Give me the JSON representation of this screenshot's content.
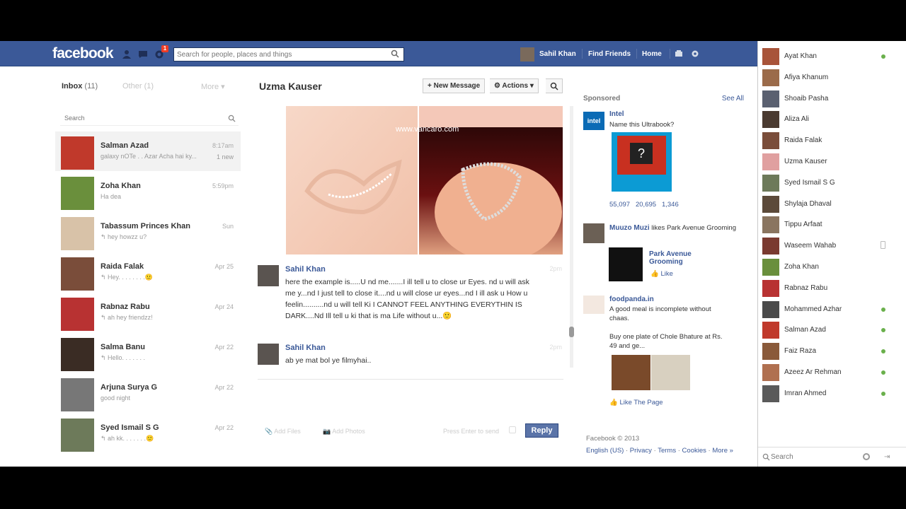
{
  "header": {
    "logo": "facebook",
    "notification_count": "1",
    "search_placeholder": "Search for people, places and things",
    "user_name": "Sahil Khan",
    "find_friends": "Find Friends",
    "home": "Home"
  },
  "inbox": {
    "title": "Inbox",
    "count": "(11)",
    "other_tab": "Other (1)",
    "more_tab": "More ▾",
    "search_placeholder": "Search",
    "threads": [
      {
        "name": "Salman Azad",
        "snippet": "galaxy nOTe . . Azar Acha hai ky...",
        "time": "8:17am",
        "badge": "1 new",
        "color": "#c0392b"
      },
      {
        "name": "Zoha Khan",
        "snippet": "Ha dea",
        "time": "5:59pm",
        "badge": "",
        "color": "#6a8f3c"
      },
      {
        "name": "Tabassum Princes Khan",
        "snippet": "↰ hey howzz u?",
        "time": "Sun",
        "badge": "",
        "color": "#d8c2a8"
      },
      {
        "name": "Raida Falak",
        "snippet": "↰ Hey. . . . . . . .🙂",
        "time": "Apr 25",
        "badge": "",
        "color": "#7a4d3a"
      },
      {
        "name": "Rabnaz Rabu",
        "snippet": "↰ ah hey friendzz!",
        "time": "Apr 24",
        "badge": "",
        "color": "#b83232"
      },
      {
        "name": "Salma Banu",
        "snippet": "↰ Hello. . . . . . .",
        "time": "Apr 22",
        "badge": "",
        "color": "#3a2c24"
      },
      {
        "name": "Arjuna Surya G",
        "snippet": "good night",
        "time": "Apr 22",
        "badge": "",
        "color": "#777777"
      },
      {
        "name": "Syed Ismail S G",
        "snippet": "↰ ah kk. . . . . . .🙂",
        "time": "Apr 22",
        "badge": "",
        "color": "#6d7a5a"
      }
    ]
  },
  "conversation": {
    "title": "Uzma Kauser",
    "new_message": "+ New Message",
    "actions": "⚙ Actions ▾",
    "photo_watermark": "www.vancaro.com",
    "messages": [
      {
        "name": "Sahil Khan",
        "time": "2pm",
        "text": "here the example is.....U nd me.......I ill tell u to close ur Eyes. nd u will ask me y...nd I just tell to close it....nd u will close ur eyes...nd I ill ask u How u feelin..........nd u will tell Ki I CANNOT FEEL ANYTHING EVERYTHIN IS DARK....Nd Ill tell u ki that is ma Life without u...🙂"
      },
      {
        "name": "Sahil Khan",
        "time": "2pm",
        "text": "ab ye mat bol ye filmyhai.."
      }
    ],
    "add_files": "Add Files",
    "add_photos": "Add Photos",
    "press_enter": "Press Enter to send",
    "reply": "Reply"
  },
  "ads": {
    "sponsored": "Sponsored",
    "see_all": "See All",
    "intel": {
      "name": "Intel",
      "text": "Name this Ultrabook?",
      "stats": [
        "55,097",
        "20,695",
        "1,346"
      ]
    },
    "social": {
      "name": "Muuzo Muzi",
      "text": "likes Park Avenue Grooming",
      "page": "Park Avenue Grooming",
      "like": "Like"
    },
    "foodpanda": {
      "name": "foodpanda.in",
      "text1": "A good meal is incomplete without chaas.",
      "text2": "Buy one plate of Chole Bhature at Rs. 49 and ge...",
      "like_page": "Like The Page"
    },
    "footer_copy": "Facebook © 2013",
    "footer_links": [
      "English (US)",
      "Privacy",
      "Terms",
      "Cookies",
      "More »"
    ]
  },
  "chat": {
    "friends": [
      {
        "name": "Ayat Khan",
        "status": "online",
        "color": "#a8543a"
      },
      {
        "name": "Afiya Khanum",
        "status": "",
        "color": "#9b6b4a"
      },
      {
        "name": "Shoaib Pasha",
        "status": "",
        "color": "#5a6070"
      },
      {
        "name": "Aliza Ali",
        "status": "",
        "color": "#4a3a30"
      },
      {
        "name": "Raida Falak",
        "status": "",
        "color": "#7a4d3a"
      },
      {
        "name": "Uzma Kauser",
        "status": "",
        "color": "#e0a0a0"
      },
      {
        "name": "Syed Ismail S G",
        "status": "",
        "color": "#6d7a5a"
      },
      {
        "name": "Shylaja Dhaval",
        "status": "",
        "color": "#5c4a3a"
      },
      {
        "name": "Tippu Arfaat",
        "status": "",
        "color": "#8a7560"
      },
      {
        "name": "Waseem Wahab",
        "status": "mobile",
        "color": "#7a3a30"
      },
      {
        "name": "Zoha Khan",
        "status": "",
        "color": "#6a8f3c"
      },
      {
        "name": "Rabnaz Rabu",
        "status": "",
        "color": "#b83232"
      },
      {
        "name": "Mohammed Azhar",
        "status": "online",
        "color": "#4a4a4a"
      },
      {
        "name": "Salman Azad",
        "status": "online",
        "color": "#c0392b"
      },
      {
        "name": "Faiz Raza",
        "status": "online",
        "color": "#8a5a3a"
      },
      {
        "name": "Azeez Ar Rehman",
        "status": "online",
        "color": "#b07050"
      },
      {
        "name": "Imran Ahmed",
        "status": "online",
        "color": "#5a5a5a"
      }
    ],
    "search": "Search"
  }
}
